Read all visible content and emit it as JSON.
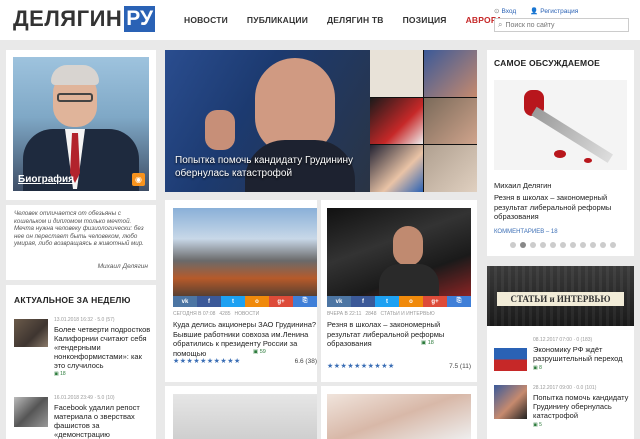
{
  "header": {
    "logo_text": "ДЕЛЯГИН",
    "logo_badge": "РУ",
    "nav": [
      "НОВОСТИ",
      "ПУБЛИКАЦИИ",
      "ДЕЛЯГИН ТВ",
      "ПОЗИЦИЯ",
      "АВРОРА"
    ],
    "login": "Вход",
    "register": "Регистрация",
    "search_placeholder": "Поиск по сайту"
  },
  "bio": {
    "label": "Биография",
    "quote": "Человек отличается от обезьяны с кошельком и дипломом только мечтой. Мечта нужна человеку физиологически: без нее он перестает быть человеком, любо умирая, либо возвращаясь в животный мир.",
    "author": "Михаил Делягин"
  },
  "hero": {
    "caption": "Попытка помочь кандидату Грудинину обернулась катастрофой"
  },
  "actual": {
    "title": "АКТУАЛЬНОЕ ЗА НЕДЕЛЮ",
    "items": [
      {
        "meta": "13.01.2018 16:32 · 5.0 (57)",
        "text": "Более четверти подростков Калифорнии считают себя «гендерными нонконформистами»: как это случилось",
        "comments": "18"
      },
      {
        "meta": "16.01.2018 23:49 · 5.0 (10)",
        "text": "Facebook удалил репост материала о зверствах фашистов за «демонстрацию"
      }
    ]
  },
  "center": {
    "cards": [
      {
        "meta_date": "СЕГОДНЯ В 07:08",
        "meta_views": "4285",
        "meta_cat": "НОВОСТИ",
        "text": "Куда делись акционеры ЗАО Грудинина? Бывшие работники совхоза им.Ленина обратились к президенту России за помощью",
        "comments": "59",
        "rating": "6.6 (38)"
      },
      {
        "meta_date": "ВЧЕРА В 22:11",
        "meta_views": "2848",
        "meta_cat": "СТАТЬИ И ИНТЕРВЬЮ",
        "text": "Резня в школах – закономерный результат либеральной реформы образования",
        "comments": "18",
        "rating": "7.5 (11)"
      }
    ]
  },
  "discussed": {
    "title": "САМОЕ ОБСУЖДАЕМОЕ",
    "author": "Михаил Делягин",
    "text": "Резня в школах – закономерный результат либеральной реформы образования",
    "comments_label": "КОММЕНТАРИЕВ – 18"
  },
  "articles": {
    "banner": "СТАТЬИ и ИНТЕРВЬЮ",
    "items": [
      {
        "meta": "08.12.2017 07:00 · 0 (183)",
        "text": "Экономику РФ ждёт разрушительный переход",
        "comments": "8"
      },
      {
        "meta": "28.12.2017 09:00 · 0.0 (101)",
        "text": "Попытка помочь кандидату Грудинину обернулась катастрофой",
        "comments": "5"
      }
    ]
  },
  "colors": {
    "accent": "#2a62b5",
    "red": "#c62828",
    "stars": "#3b6eb5"
  }
}
